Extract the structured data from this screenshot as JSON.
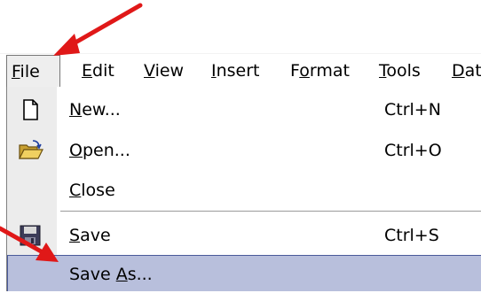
{
  "menubar": {
    "items": [
      {
        "mnemonic": "F",
        "rest": "ile"
      },
      {
        "mnemonic": "E",
        "rest": "dit"
      },
      {
        "mnemonic": "V",
        "rest": "iew"
      },
      {
        "mnemonic": "I",
        "rest": "nsert"
      },
      {
        "before": "F",
        "mnemonic": "o",
        "rest": "rmat"
      },
      {
        "mnemonic": "T",
        "rest": "ools"
      },
      {
        "mnemonic": "D",
        "rest": "at"
      }
    ]
  },
  "file_menu": {
    "new": {
      "mnemonic": "N",
      "rest": "ew...",
      "shortcut": "Ctrl+N",
      "icon": "new-document-icon"
    },
    "open": {
      "mnemonic": "O",
      "rest": "pen...",
      "shortcut": "Ctrl+O",
      "icon": "open-folder-icon"
    },
    "close": {
      "mnemonic": "C",
      "rest": "lose"
    },
    "save": {
      "mnemonic": "S",
      "rest": "ave",
      "shortcut": "Ctrl+S",
      "icon": "floppy-disk-icon"
    },
    "save_as": {
      "before": "Save ",
      "mnemonic": "A",
      "rest": "s..."
    }
  },
  "colors": {
    "highlight": "#b8bfdc",
    "highlight_border": "#4a5a9a",
    "icon_column": "#ececec",
    "arrow": "#e01818"
  }
}
